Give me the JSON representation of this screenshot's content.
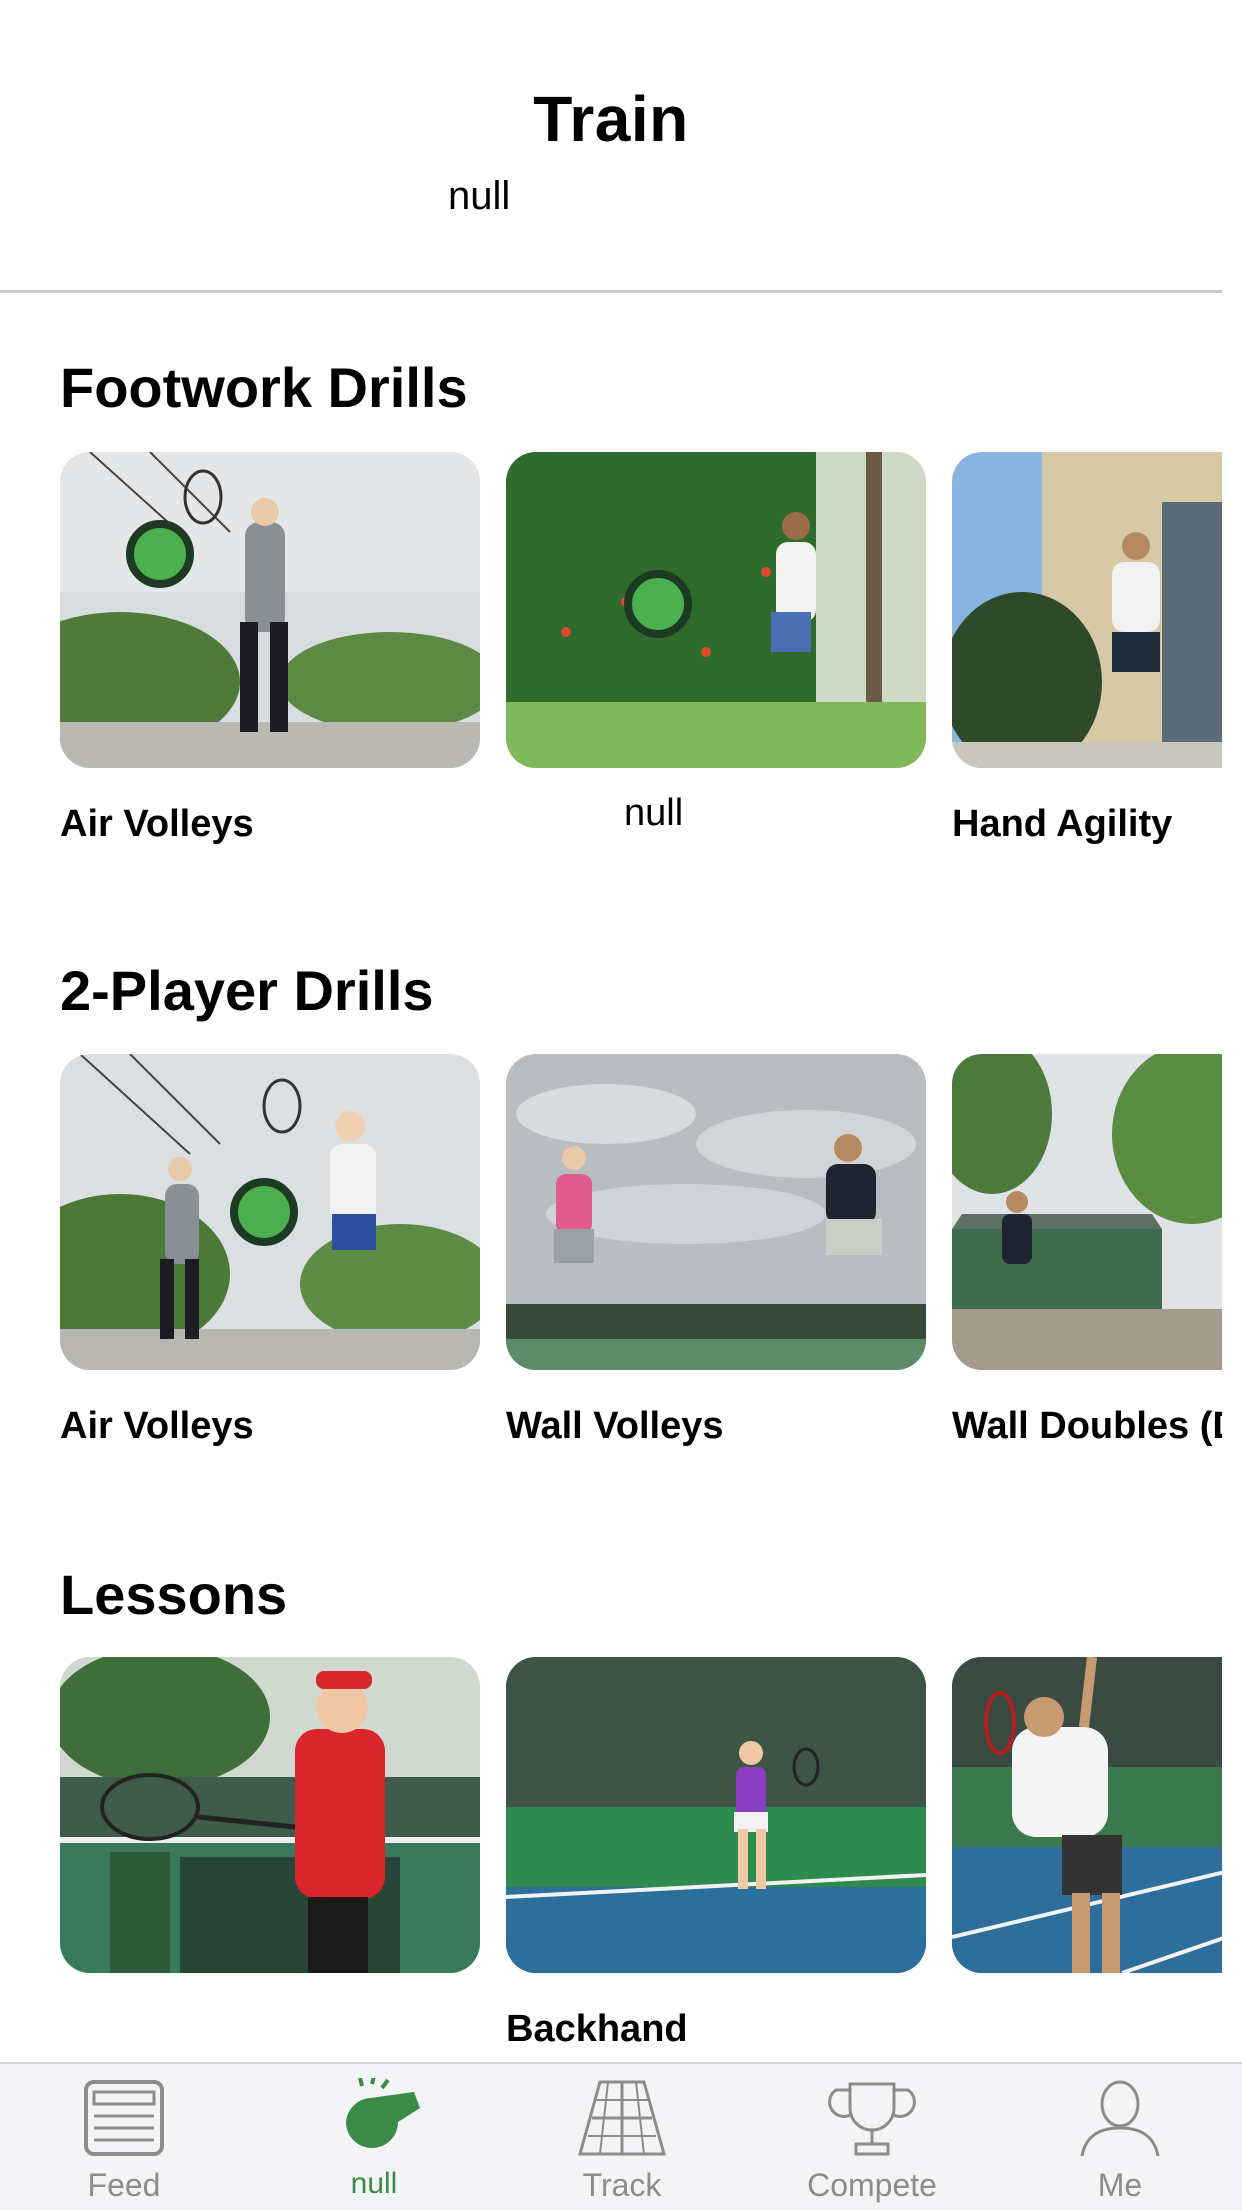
{
  "header": {
    "title": "Train",
    "subtitle": "null"
  },
  "sections": [
    {
      "title": "Footwork Drills",
      "items": [
        {
          "label": "Air Volleys"
        },
        {
          "label": "null"
        },
        {
          "label": "Hand Agility"
        }
      ]
    },
    {
      "title": "2-Player Drills",
      "items": [
        {
          "label": "Air Volleys"
        },
        {
          "label": "Wall Volleys"
        },
        {
          "label": "Wall Doubles (D"
        }
      ]
    },
    {
      "title": "Lessons",
      "items": [
        {
          "label": ""
        },
        {
          "label": "Backhand"
        },
        {
          "label": ""
        }
      ]
    }
  ],
  "tabbar": {
    "tabs": [
      {
        "label": "Feed",
        "icon": "feed-icon"
      },
      {
        "label": "null",
        "icon": "whistle-icon",
        "active": true
      },
      {
        "label": "Track",
        "icon": "court-icon"
      },
      {
        "label": "Compete",
        "icon": "trophy-icon"
      },
      {
        "label": "Me",
        "icon": "person-icon"
      }
    ]
  },
  "colors": {
    "accent": "#3b8a47",
    "marker": "#4caf50",
    "tab_inactive": "#8c8c8c"
  }
}
